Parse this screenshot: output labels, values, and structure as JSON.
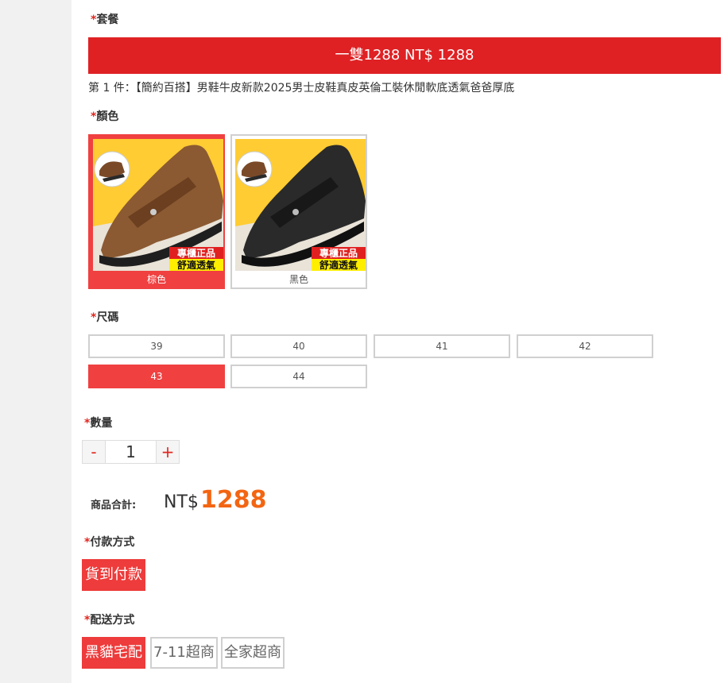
{
  "required_mark": "*",
  "package": {
    "label": "套餐",
    "option_label": "一雙1288 NT$ 1288",
    "description": "第 1 件：【簡約百搭】男鞋牛皮新款2025男士皮鞋真皮英倫工裝休閒軟底透氣爸爸厚底"
  },
  "color": {
    "label": "顏色",
    "badge_line1": "專櫃正品",
    "badge_line2": "舒適透氣",
    "options": [
      {
        "name": "棕色",
        "selected": true
      },
      {
        "name": "黑色",
        "selected": false
      }
    ]
  },
  "size": {
    "label": "尺碼",
    "options": [
      "39",
      "40",
      "41",
      "42",
      "43",
      "44"
    ],
    "selected": "43"
  },
  "quantity": {
    "label": "數量",
    "minus": "-",
    "value": "1",
    "plus": "+"
  },
  "total": {
    "label": "商品合計:",
    "currency": "NT$",
    "amount": "1288"
  },
  "payment": {
    "label": "付款方式",
    "options": [
      {
        "name": "貨到付款",
        "selected": true
      }
    ]
  },
  "shipping": {
    "label": "配送方式",
    "options": [
      {
        "name": "黑貓宅配",
        "selected": true
      },
      {
        "name": "7-11超商",
        "selected": false
      },
      {
        "name": "全家超商",
        "selected": false
      }
    ]
  },
  "colors": {
    "accent": "#df2124",
    "selected": "#f04040",
    "price": "#f36512",
    "thumb_bg": "#ffcc33"
  }
}
